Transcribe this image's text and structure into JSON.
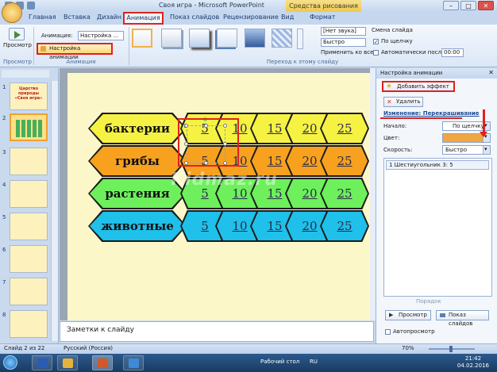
{
  "window": {
    "title": "Своя игра - Microsoft PowerPoint",
    "context_tab_title": "Средства рисования"
  },
  "tabs": [
    {
      "label": "Главная"
    },
    {
      "label": "Вставка"
    },
    {
      "label": "Дизайн"
    },
    {
      "label": "Анимация",
      "active": true
    },
    {
      "label": "Показ слайдов"
    },
    {
      "label": "Рецензирование"
    },
    {
      "label": "Вид"
    },
    {
      "label": "Формат"
    }
  ],
  "ribbon": {
    "preview_label": "Просмотр",
    "preview_group": "Просмотр",
    "animation_label": "Анимация:",
    "animation_value": "Настройка ...",
    "custom_animation_label": "Настройка анимации",
    "animation_group": "Анимация",
    "transition_group": "Переход к этому слайду",
    "sound_value": "[Нет звука]",
    "speed_value": "Быстро",
    "apply_all_label": "Применить ко всем",
    "change_slide_label": "Смена слайда",
    "on_click_label": "По щелчку",
    "auto_after_label": "Автоматически после:",
    "time_value": "00:00"
  },
  "slides_panel": {
    "slide1_title": "Царство природы",
    "slide1_subtitle": "«Своя игра»",
    "numbers": [
      "1",
      "2",
      "3",
      "4",
      "5",
      "6",
      "7",
      "8"
    ]
  },
  "slide": {
    "rows": [
      {
        "category": "бактерии",
        "values": [
          "5",
          "10",
          "15",
          "20",
          "25"
        ],
        "color": "#f6f244"
      },
      {
        "category": "грибы",
        "values": [
          "5",
          "10",
          "15",
          "20",
          "25"
        ],
        "color": "#f7a11f"
      },
      {
        "category": "растения",
        "values": [
          "5",
          "10",
          "15",
          "20",
          "25"
        ],
        "color": "#6df05c"
      },
      {
        "category": "животные",
        "values": [
          "5",
          "10",
          "15",
          "20",
          "25"
        ],
        "color": "#1fc0ea"
      }
    ],
    "selected_badge": "1",
    "watermark": "Kidmaz.ru"
  },
  "notes": {
    "placeholder": "Заметки к слайду"
  },
  "task_pane": {
    "title": "Настройка анимации",
    "add_effect_label": "Добавить эффект",
    "delete_label": "Удалить",
    "change_label": "Изменение: Перекрашивание",
    "start_label": "Начало:",
    "start_value": "По щелчку",
    "color_label": "Цвет:",
    "speed_label": "Скорость:",
    "speed_value": "Быстро",
    "effect_item": "1  Шестиугольник 3: 5",
    "order_label": "Порядок",
    "play_label": "Просмотр",
    "show_label": "Показ слайдов",
    "autopreview_label": "Автопросмотр",
    "color_swatch": "#f2a541"
  },
  "status_bar": {
    "slide_info": "Слайд 2 из 22",
    "language": "Русский (Россия)",
    "zoom": "70%"
  },
  "taskbar": {
    "desktop_label": "Рабочий стол",
    "lang": "RU",
    "time": "21:42",
    "date": "04.02.2016"
  }
}
